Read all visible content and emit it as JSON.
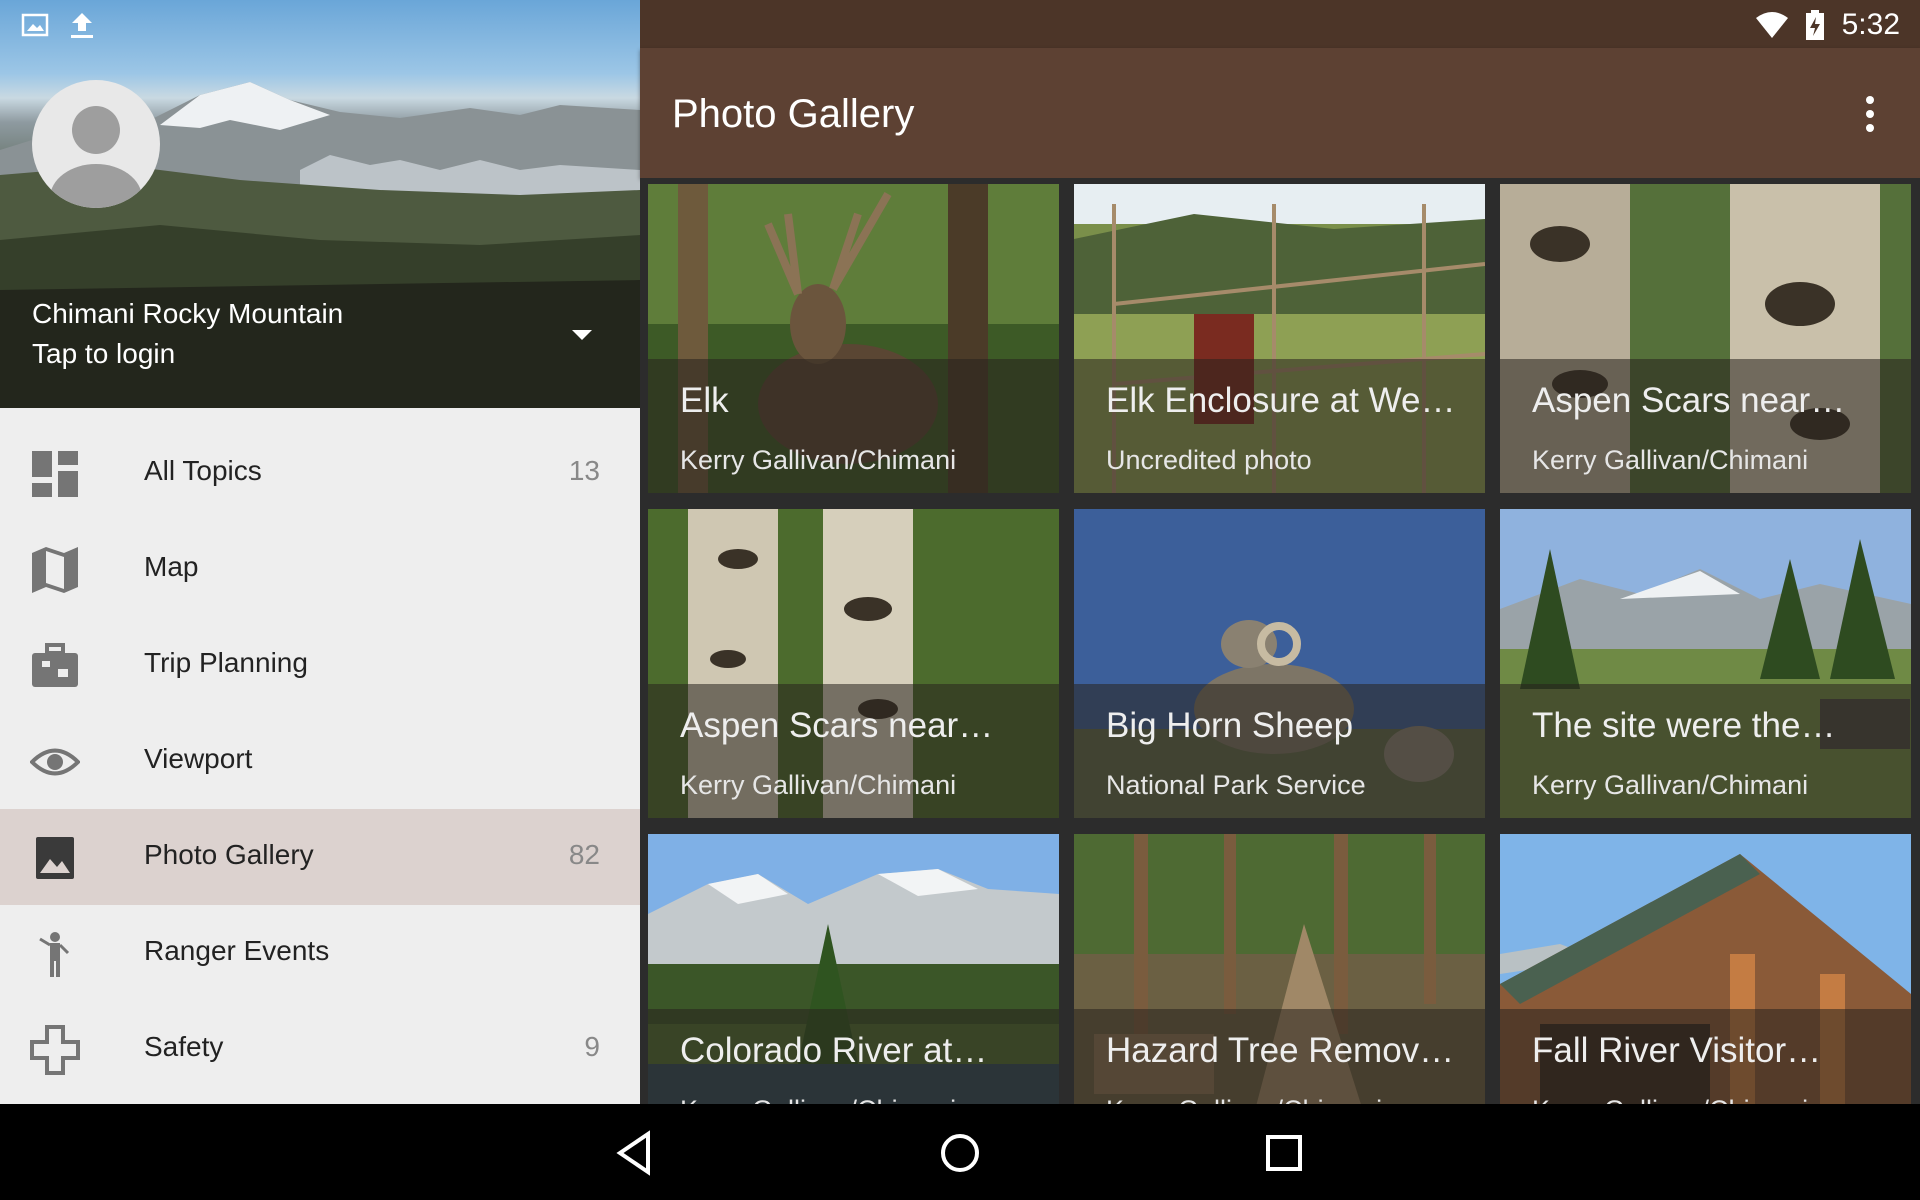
{
  "drawer": {
    "app_name": "Chimani Rocky Mountain",
    "login_text": "Tap to login",
    "items": [
      {
        "label": "All Topics",
        "count": "13",
        "icon": "dashboard-icon"
      },
      {
        "label": "Map",
        "count": "",
        "icon": "map-icon"
      },
      {
        "label": "Trip Planning",
        "count": "",
        "icon": "luggage-icon"
      },
      {
        "label": "Viewport",
        "count": "",
        "icon": "eye-icon"
      },
      {
        "label": "Photo Gallery",
        "count": "82",
        "icon": "image-icon",
        "active": true
      },
      {
        "label": "Ranger Events",
        "count": "",
        "icon": "ranger-icon"
      },
      {
        "label": "Safety",
        "count": "9",
        "icon": "cross-icon"
      }
    ]
  },
  "status_bar": {
    "time": "5:32"
  },
  "app_bar": {
    "title": "Photo Gallery"
  },
  "gallery": {
    "tiles": [
      {
        "title": "Elk",
        "credit": "Kerry Gallivan/Chimani"
      },
      {
        "title": "Elk Enclosure at We…",
        "credit": "Uncredited photo"
      },
      {
        "title": "Aspen Scars near…",
        "credit": "Kerry Gallivan/Chimani"
      },
      {
        "title": "Aspen Scars near…",
        "credit": "Kerry Gallivan/Chimani"
      },
      {
        "title": "Big Horn Sheep",
        "credit": "National Park Service"
      },
      {
        "title": "The site were the…",
        "credit": "Kerry Gallivan/Chimani"
      },
      {
        "title": "Colorado River at…",
        "credit": "Kerry Gallivan/Chimani"
      },
      {
        "title": "Hazard Tree Remov…",
        "credit": "Kerry Gallivan/Chimani"
      },
      {
        "title": "Fall River Visitor…",
        "credit": "Kerry Gallivan/Chimani"
      }
    ]
  },
  "colors": {
    "app_bar": "#5d4133",
    "status_bar": "#4c3528",
    "drawer_bg": "#eeeeee",
    "active_item": "#dcd2cf"
  }
}
